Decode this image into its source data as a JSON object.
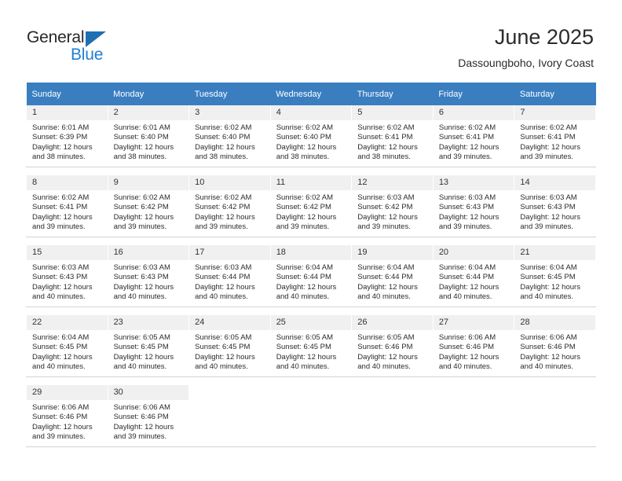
{
  "logo": {
    "primary_text": "General",
    "secondary_text": "Blue",
    "primary_color": "#27282a",
    "secondary_color": "#1f7fd0",
    "triangle_color": "#1f6fb4"
  },
  "header": {
    "title": "June 2025",
    "subtitle": "Dassoungboho, Ivory Coast"
  },
  "theme": {
    "header_row_bg": "#3a7ec0",
    "header_row_text": "#ffffff",
    "daynum_bg": "#f0f0f0",
    "cell_border": "#cfd3d6",
    "text": "#2b2b2b"
  },
  "weekday_headers": [
    "Sunday",
    "Monday",
    "Tuesday",
    "Wednesday",
    "Thursday",
    "Friday",
    "Saturday"
  ],
  "weeks": [
    {
      "days": [
        {
          "day": "1",
          "sunrise": "Sunrise: 6:01 AM",
          "sunset": "Sunset: 6:39 PM",
          "daylight_line1": "Daylight: 12 hours",
          "daylight_line2": "and 38 minutes."
        },
        {
          "day": "2",
          "sunrise": "Sunrise: 6:01 AM",
          "sunset": "Sunset: 6:40 PM",
          "daylight_line1": "Daylight: 12 hours",
          "daylight_line2": "and 38 minutes."
        },
        {
          "day": "3",
          "sunrise": "Sunrise: 6:02 AM",
          "sunset": "Sunset: 6:40 PM",
          "daylight_line1": "Daylight: 12 hours",
          "daylight_line2": "and 38 minutes."
        },
        {
          "day": "4",
          "sunrise": "Sunrise: 6:02 AM",
          "sunset": "Sunset: 6:40 PM",
          "daylight_line1": "Daylight: 12 hours",
          "daylight_line2": "and 38 minutes."
        },
        {
          "day": "5",
          "sunrise": "Sunrise: 6:02 AM",
          "sunset": "Sunset: 6:41 PM",
          "daylight_line1": "Daylight: 12 hours",
          "daylight_line2": "and 38 minutes."
        },
        {
          "day": "6",
          "sunrise": "Sunrise: 6:02 AM",
          "sunset": "Sunset: 6:41 PM",
          "daylight_line1": "Daylight: 12 hours",
          "daylight_line2": "and 39 minutes."
        },
        {
          "day": "7",
          "sunrise": "Sunrise: 6:02 AM",
          "sunset": "Sunset: 6:41 PM",
          "daylight_line1": "Daylight: 12 hours",
          "daylight_line2": "and 39 minutes."
        }
      ]
    },
    {
      "days": [
        {
          "day": "8",
          "sunrise": "Sunrise: 6:02 AM",
          "sunset": "Sunset: 6:41 PM",
          "daylight_line1": "Daylight: 12 hours",
          "daylight_line2": "and 39 minutes."
        },
        {
          "day": "9",
          "sunrise": "Sunrise: 6:02 AM",
          "sunset": "Sunset: 6:42 PM",
          "daylight_line1": "Daylight: 12 hours",
          "daylight_line2": "and 39 minutes."
        },
        {
          "day": "10",
          "sunrise": "Sunrise: 6:02 AM",
          "sunset": "Sunset: 6:42 PM",
          "daylight_line1": "Daylight: 12 hours",
          "daylight_line2": "and 39 minutes."
        },
        {
          "day": "11",
          "sunrise": "Sunrise: 6:02 AM",
          "sunset": "Sunset: 6:42 PM",
          "daylight_line1": "Daylight: 12 hours",
          "daylight_line2": "and 39 minutes."
        },
        {
          "day": "12",
          "sunrise": "Sunrise: 6:03 AM",
          "sunset": "Sunset: 6:42 PM",
          "daylight_line1": "Daylight: 12 hours",
          "daylight_line2": "and 39 minutes."
        },
        {
          "day": "13",
          "sunrise": "Sunrise: 6:03 AM",
          "sunset": "Sunset: 6:43 PM",
          "daylight_line1": "Daylight: 12 hours",
          "daylight_line2": "and 39 minutes."
        },
        {
          "day": "14",
          "sunrise": "Sunrise: 6:03 AM",
          "sunset": "Sunset: 6:43 PM",
          "daylight_line1": "Daylight: 12 hours",
          "daylight_line2": "and 39 minutes."
        }
      ]
    },
    {
      "days": [
        {
          "day": "15",
          "sunrise": "Sunrise: 6:03 AM",
          "sunset": "Sunset: 6:43 PM",
          "daylight_line1": "Daylight: 12 hours",
          "daylight_line2": "and 40 minutes."
        },
        {
          "day": "16",
          "sunrise": "Sunrise: 6:03 AM",
          "sunset": "Sunset: 6:43 PM",
          "daylight_line1": "Daylight: 12 hours",
          "daylight_line2": "and 40 minutes."
        },
        {
          "day": "17",
          "sunrise": "Sunrise: 6:03 AM",
          "sunset": "Sunset: 6:44 PM",
          "daylight_line1": "Daylight: 12 hours",
          "daylight_line2": "and 40 minutes."
        },
        {
          "day": "18",
          "sunrise": "Sunrise: 6:04 AM",
          "sunset": "Sunset: 6:44 PM",
          "daylight_line1": "Daylight: 12 hours",
          "daylight_line2": "and 40 minutes."
        },
        {
          "day": "19",
          "sunrise": "Sunrise: 6:04 AM",
          "sunset": "Sunset: 6:44 PM",
          "daylight_line1": "Daylight: 12 hours",
          "daylight_line2": "and 40 minutes."
        },
        {
          "day": "20",
          "sunrise": "Sunrise: 6:04 AM",
          "sunset": "Sunset: 6:44 PM",
          "daylight_line1": "Daylight: 12 hours",
          "daylight_line2": "and 40 minutes."
        },
        {
          "day": "21",
          "sunrise": "Sunrise: 6:04 AM",
          "sunset": "Sunset: 6:45 PM",
          "daylight_line1": "Daylight: 12 hours",
          "daylight_line2": "and 40 minutes."
        }
      ]
    },
    {
      "days": [
        {
          "day": "22",
          "sunrise": "Sunrise: 6:04 AM",
          "sunset": "Sunset: 6:45 PM",
          "daylight_line1": "Daylight: 12 hours",
          "daylight_line2": "and 40 minutes."
        },
        {
          "day": "23",
          "sunrise": "Sunrise: 6:05 AM",
          "sunset": "Sunset: 6:45 PM",
          "daylight_line1": "Daylight: 12 hours",
          "daylight_line2": "and 40 minutes."
        },
        {
          "day": "24",
          "sunrise": "Sunrise: 6:05 AM",
          "sunset": "Sunset: 6:45 PM",
          "daylight_line1": "Daylight: 12 hours",
          "daylight_line2": "and 40 minutes."
        },
        {
          "day": "25",
          "sunrise": "Sunrise: 6:05 AM",
          "sunset": "Sunset: 6:45 PM",
          "daylight_line1": "Daylight: 12 hours",
          "daylight_line2": "and 40 minutes."
        },
        {
          "day": "26",
          "sunrise": "Sunrise: 6:05 AM",
          "sunset": "Sunset: 6:46 PM",
          "daylight_line1": "Daylight: 12 hours",
          "daylight_line2": "and 40 minutes."
        },
        {
          "day": "27",
          "sunrise": "Sunrise: 6:06 AM",
          "sunset": "Sunset: 6:46 PM",
          "daylight_line1": "Daylight: 12 hours",
          "daylight_line2": "and 40 minutes."
        },
        {
          "day": "28",
          "sunrise": "Sunrise: 6:06 AM",
          "sunset": "Sunset: 6:46 PM",
          "daylight_line1": "Daylight: 12 hours",
          "daylight_line2": "and 40 minutes."
        }
      ]
    },
    {
      "days": [
        {
          "day": "29",
          "sunrise": "Sunrise: 6:06 AM",
          "sunset": "Sunset: 6:46 PM",
          "daylight_line1": "Daylight: 12 hours",
          "daylight_line2": "and 39 minutes."
        },
        {
          "day": "30",
          "sunrise": "Sunrise: 6:06 AM",
          "sunset": "Sunset: 6:46 PM",
          "daylight_line1": "Daylight: 12 hours",
          "daylight_line2": "and 39 minutes."
        },
        {
          "day": "",
          "sunrise": "",
          "sunset": "",
          "daylight_line1": "",
          "daylight_line2": ""
        },
        {
          "day": "",
          "sunrise": "",
          "sunset": "",
          "daylight_line1": "",
          "daylight_line2": ""
        },
        {
          "day": "",
          "sunrise": "",
          "sunset": "",
          "daylight_line1": "",
          "daylight_line2": ""
        },
        {
          "day": "",
          "sunrise": "",
          "sunset": "",
          "daylight_line1": "",
          "daylight_line2": ""
        },
        {
          "day": "",
          "sunrise": "",
          "sunset": "",
          "daylight_line1": "",
          "daylight_line2": ""
        }
      ]
    }
  ]
}
